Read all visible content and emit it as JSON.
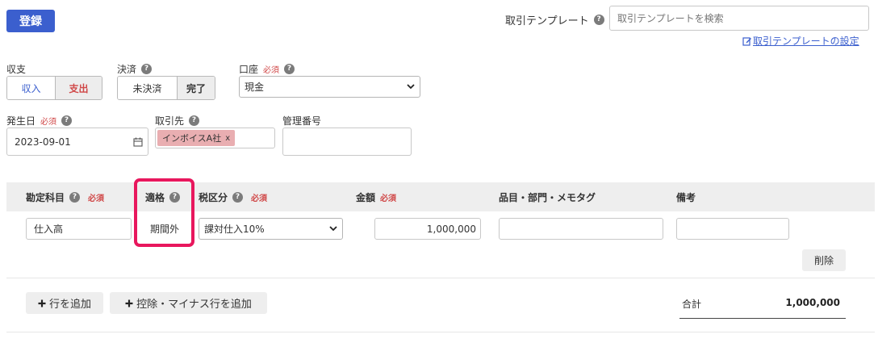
{
  "header": {
    "register_label": "登録",
    "template_label": "取引テンプレート",
    "template_search_placeholder": "取引テンプレートを検索",
    "template_settings_link": "取引テンプレートの設定"
  },
  "form": {
    "income_expense": {
      "label": "収支",
      "options": [
        "収入",
        "支出"
      ],
      "selected": "支出"
    },
    "settlement": {
      "label": "決済",
      "options": [
        "未決済",
        "完了"
      ],
      "selected": "完了"
    },
    "account": {
      "label": "口座",
      "required": "必須",
      "value": "現金"
    },
    "date": {
      "label": "発生日",
      "required": "必須",
      "value": "2023-09-01"
    },
    "partner": {
      "label": "取引先",
      "tag": "インボイスA社",
      "tag_remove": "x"
    },
    "ref_number": {
      "label": "管理番号",
      "value": ""
    }
  },
  "table": {
    "headers": {
      "account_item": "勘定科目",
      "account_item_required": "必須",
      "qualified": "適格",
      "tax_class": "税区分",
      "tax_class_required": "必須",
      "amount": "金額",
      "amount_required": "必須",
      "item_tags": "品目・部門・メモタグ",
      "notes": "備考"
    },
    "rows": [
      {
        "account_item": "仕入高",
        "qualified": "期間外",
        "tax_class": "課対仕入10%",
        "amount": "1,000,000",
        "item_tags": "",
        "notes": "",
        "delete_label": "削除"
      }
    ]
  },
  "footer": {
    "add_row_label": "行を追加",
    "add_deduction_row_label": "控除・マイナス行を追加",
    "total_label": "合計",
    "total_value": "1,000,000"
  },
  "colors": {
    "primary": "#3b5fce",
    "required": "#d04848",
    "highlight": "#e8175d",
    "tag_bg": "#e9aeb1"
  }
}
